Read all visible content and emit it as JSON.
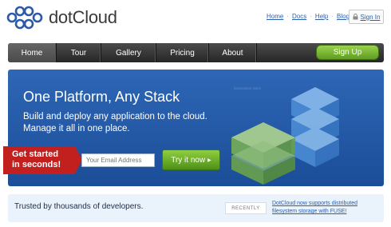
{
  "brand": {
    "name": "dotCloud",
    "logo_icon": "dotcloud-logo-icon",
    "color": "#2a5aa8"
  },
  "top_links": [
    "Home",
    "Docs",
    "Help",
    "Blog"
  ],
  "signin_label": "Sign In",
  "nav": {
    "items": [
      "Home",
      "Tour",
      "Gallery",
      "Pricing",
      "About"
    ],
    "active": "Home",
    "signup_label": "Sign Up"
  },
  "hero": {
    "title": "One Platform, Any Stack",
    "subtitle": "Build and deploy any application to the cloud. Manage it all in one place.",
    "tiny_text": "lalalalalalal alalal",
    "ribbon_label": "Get started in seconds!",
    "email_placeholder": "Your Email Address",
    "cta_label": "Try it now"
  },
  "footer_band": {
    "trusted_text": "Trusted by thousands of developers.",
    "recently_label": "RECENTLY",
    "news_link": "DotCloud now supports distributed filesystem storage with FUSE!"
  },
  "colors": {
    "nav_dark": "#2f2f2f",
    "signup_green": "#7cba35",
    "hero_blue": "#2560ad",
    "ribbon_red": "#c21f1f",
    "link_blue": "#2a5fb0"
  }
}
